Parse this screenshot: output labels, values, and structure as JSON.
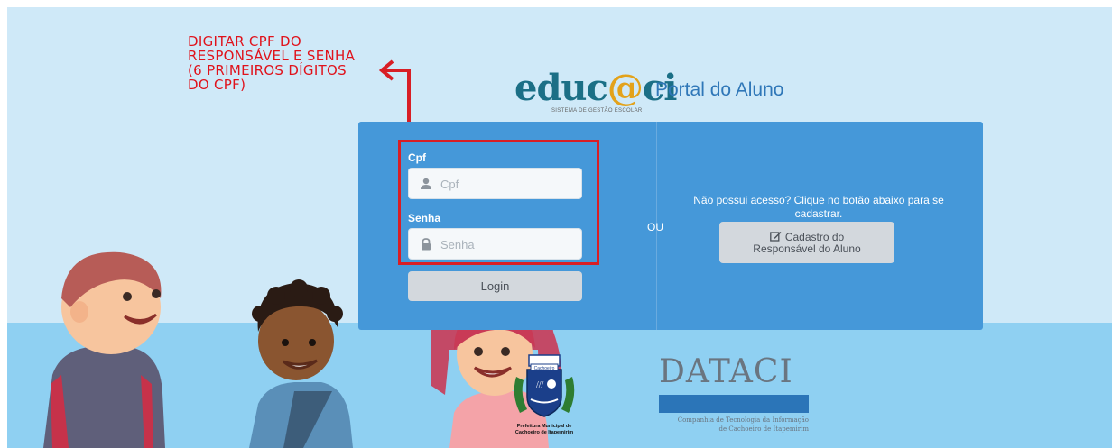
{
  "annotation": {
    "lines": [
      "DIGITAR CPF DO",
      "RESPONSÁVEL E SENHA",
      "(6 PRIMEIROS DÍGITOS",
      "DO CPF)"
    ],
    "color": "#e0121b"
  },
  "header": {
    "logo_text_a": "educ",
    "logo_text_at": "@",
    "logo_text_b": "ci",
    "logo_subtitle": "SISTEMA DE GESTÃO ESCOLAR",
    "portal_title": "Portal do Aluno"
  },
  "login_form": {
    "cpf_label": "Cpf",
    "cpf_placeholder": "Cpf",
    "cpf_icon": "user-icon",
    "senha_label": "Senha",
    "senha_placeholder": "Senha",
    "senha_icon": "lock-icon",
    "login_button": "Login"
  },
  "separator": "OU",
  "register": {
    "prompt": "Não possui acesso? Clique no botão abaixo para se cadastrar.",
    "button_line1": "Cadastro do",
    "button_line2": "Responsável do Aluno",
    "button_icon": "edit-icon"
  },
  "footer": {
    "crest_caption_line1": "Prefeitura Municipal de",
    "crest_caption_line2": "Cachoeiro de Itapemirim",
    "crest_banner": "Cachoeiro",
    "dataci_title": "DATACI",
    "dataci_sub_line1": "Companhia de Tecnologia da Informação",
    "dataci_sub_line2": "de Cachoeiro de Itapemirim"
  },
  "colors": {
    "card": "#4598d9",
    "sky": "#cfe9f8",
    "ground": "#8fd0f2",
    "highlight_border": "#d81e25",
    "brand_blue": "#2f77b8"
  }
}
